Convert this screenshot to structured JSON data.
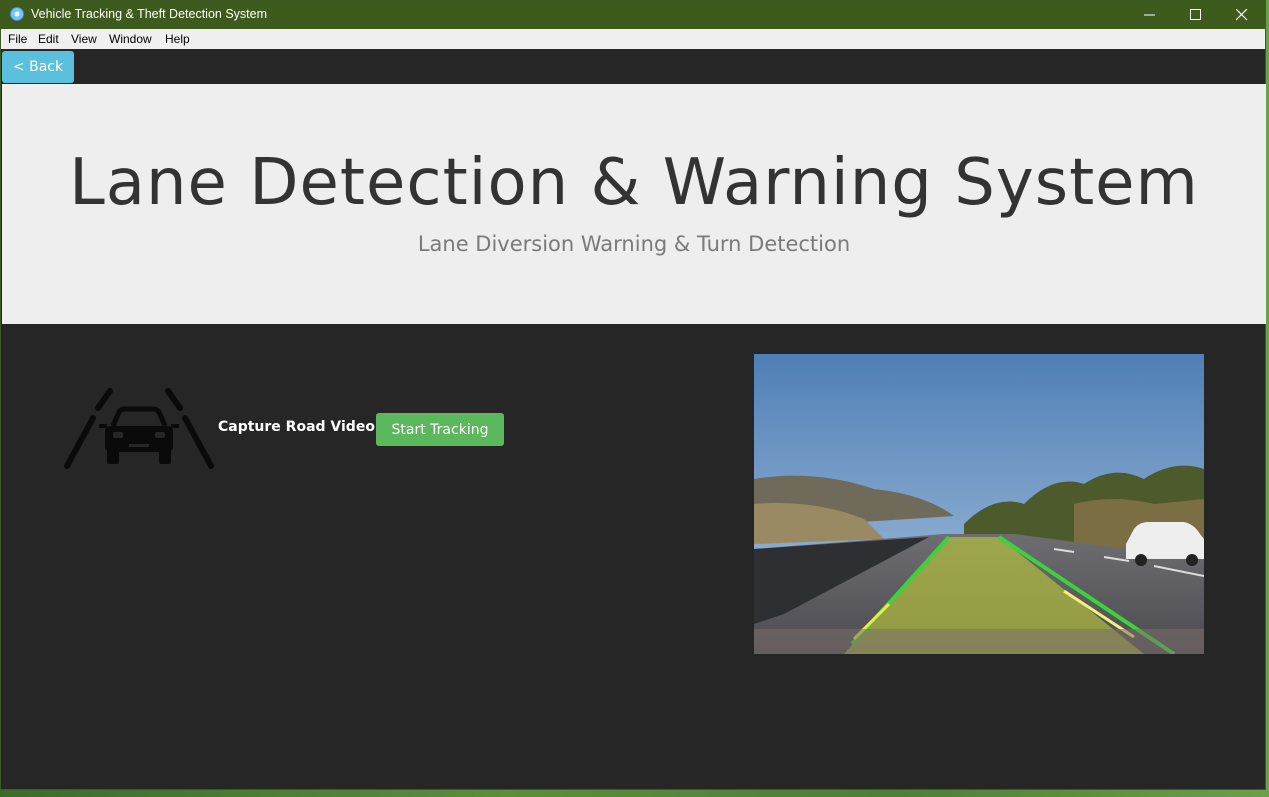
{
  "window": {
    "title": "Vehicle Tracking & Theft Detection System",
    "app_icon": "app-globe-icon"
  },
  "menubar": {
    "items": [
      "File",
      "Edit",
      "View",
      "Window",
      "Help"
    ]
  },
  "nav": {
    "back_label": "< Back"
  },
  "hero": {
    "title": "Lane Detection & Warning System",
    "subtitle": "Lane Diversion Warning & Turn Detection"
  },
  "capture": {
    "icon": "car-lane-icon",
    "label": "Capture Road Video :",
    "button_label": "Start Tracking"
  },
  "preview": {
    "icon": "road-lane-preview-image"
  },
  "colors": {
    "titlebar": "#3e5b1e",
    "back_button": "#5bc0de",
    "start_button": "#5cb85c",
    "panel": "#262626",
    "hero": "#eeeeee"
  }
}
